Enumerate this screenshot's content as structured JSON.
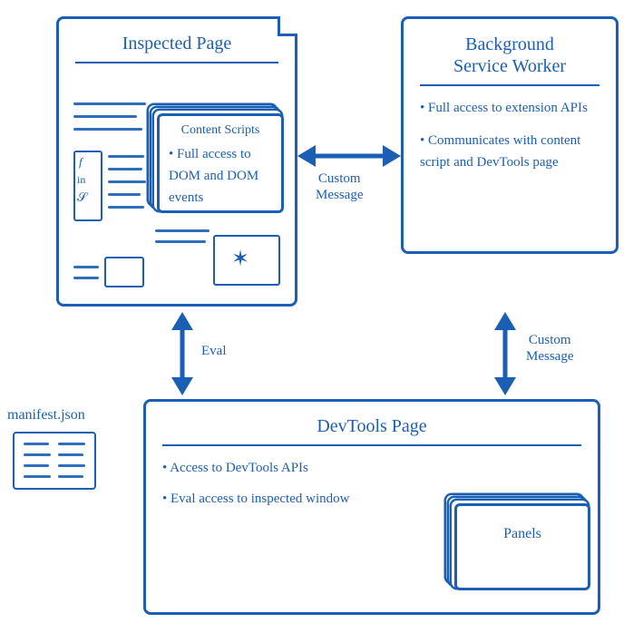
{
  "inspected": {
    "title": "Inspected Page",
    "content_scripts": {
      "title": "Content Scripts",
      "bullets": [
        "Full access to DOM and DOM events"
      ]
    }
  },
  "background": {
    "title": "Background Service Worker",
    "bullets": [
      "Full access to extension APIs",
      "Communicates with content script and DevTools page"
    ]
  },
  "devtools": {
    "title": "DevTools Page",
    "bullets": [
      "Access to DevTools APIs",
      "Eval access to inspected window"
    ],
    "panels_label": "Panels"
  },
  "manifest_label": "manifest.json",
  "arrows": {
    "custom_message_h": "Custom\nMessage",
    "eval": "Eval",
    "custom_message_v": "Custom\nMessage"
  }
}
